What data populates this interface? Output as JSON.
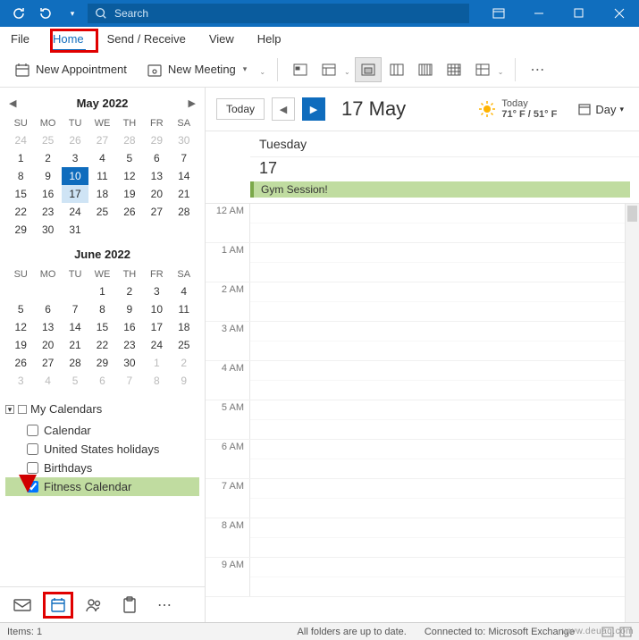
{
  "titlebar": {
    "search_placeholder": "Search"
  },
  "menutabs": {
    "file": "File",
    "home": "Home",
    "send_receive": "Send / Receive",
    "view": "View",
    "help": "Help"
  },
  "ribbon": {
    "new_appointment": "New Appointment",
    "new_meeting": "New Meeting"
  },
  "minical": {
    "may": {
      "title": "May 2022",
      "dow": [
        "SU",
        "MO",
        "TU",
        "WE",
        "TH",
        "FR",
        "SA"
      ],
      "rows": [
        [
          {
            "d": "24",
            "o": true
          },
          {
            "d": "25",
            "o": true
          },
          {
            "d": "26",
            "o": true
          },
          {
            "d": "27",
            "o": true
          },
          {
            "d": "28",
            "o": true
          },
          {
            "d": "29",
            "o": true
          },
          {
            "d": "30",
            "o": true
          }
        ],
        [
          {
            "d": "1"
          },
          {
            "d": "2"
          },
          {
            "d": "3"
          },
          {
            "d": "4"
          },
          {
            "d": "5"
          },
          {
            "d": "6"
          },
          {
            "d": "7"
          }
        ],
        [
          {
            "d": "8"
          },
          {
            "d": "9"
          },
          {
            "d": "10",
            "sel": "blue"
          },
          {
            "d": "11"
          },
          {
            "d": "12"
          },
          {
            "d": "13"
          },
          {
            "d": "14"
          }
        ],
        [
          {
            "d": "15"
          },
          {
            "d": "16"
          },
          {
            "d": "17",
            "sel": "light"
          },
          {
            "d": "18"
          },
          {
            "d": "19"
          },
          {
            "d": "20"
          },
          {
            "d": "21"
          }
        ],
        [
          {
            "d": "22"
          },
          {
            "d": "23"
          },
          {
            "d": "24"
          },
          {
            "d": "25"
          },
          {
            "d": "26"
          },
          {
            "d": "27"
          },
          {
            "d": "28"
          }
        ],
        [
          {
            "d": "29"
          },
          {
            "d": "30"
          },
          {
            "d": "31"
          },
          {
            "d": "",
            "o": true
          },
          {
            "d": "",
            "o": true
          },
          {
            "d": "",
            "o": true
          },
          {
            "d": "",
            "o": true
          }
        ]
      ]
    },
    "june": {
      "title": "June 2022",
      "dow": [
        "SU",
        "MO",
        "TU",
        "WE",
        "TH",
        "FR",
        "SA"
      ],
      "rows": [
        [
          {
            "d": "",
            "o": true
          },
          {
            "d": "",
            "o": true
          },
          {
            "d": "",
            "o": true
          },
          {
            "d": "1"
          },
          {
            "d": "2"
          },
          {
            "d": "3"
          },
          {
            "d": "4"
          }
        ],
        [
          {
            "d": "5"
          },
          {
            "d": "6"
          },
          {
            "d": "7"
          },
          {
            "d": "8"
          },
          {
            "d": "9"
          },
          {
            "d": "10"
          },
          {
            "d": "11"
          }
        ],
        [
          {
            "d": "12"
          },
          {
            "d": "13"
          },
          {
            "d": "14"
          },
          {
            "d": "15"
          },
          {
            "d": "16"
          },
          {
            "d": "17"
          },
          {
            "d": "18"
          }
        ],
        [
          {
            "d": "19"
          },
          {
            "d": "20"
          },
          {
            "d": "21"
          },
          {
            "d": "22"
          },
          {
            "d": "23"
          },
          {
            "d": "24"
          },
          {
            "d": "25"
          }
        ],
        [
          {
            "d": "26"
          },
          {
            "d": "27"
          },
          {
            "d": "28"
          },
          {
            "d": "29"
          },
          {
            "d": "30"
          },
          {
            "d": "1",
            "o": true
          },
          {
            "d": "2",
            "o": true
          }
        ],
        [
          {
            "d": "3",
            "o": true
          },
          {
            "d": "4",
            "o": true
          },
          {
            "d": "5",
            "o": true
          },
          {
            "d": "6",
            "o": true
          },
          {
            "d": "7",
            "o": true
          },
          {
            "d": "8",
            "o": true
          },
          {
            "d": "9",
            "o": true
          }
        ]
      ]
    }
  },
  "caltree": {
    "header": "My Calendars",
    "items": [
      {
        "label": "Calendar",
        "checked": false,
        "selected": false
      },
      {
        "label": "United States holidays",
        "checked": false,
        "selected": false
      },
      {
        "label": "Birthdays",
        "checked": false,
        "selected": false
      },
      {
        "label": "Fitness Calendar",
        "checked": true,
        "selected": true
      }
    ]
  },
  "calhead": {
    "today": "Today",
    "date": "17 May",
    "weather_label": "Today",
    "weather_temp": "71° F / 51° F",
    "view_label": "Day"
  },
  "day": {
    "dayname": "Tuesday",
    "daynum": "17",
    "event": "Gym Session!",
    "times": [
      "12 AM",
      "1 AM",
      "2 AM",
      "3 AM",
      "4 AM",
      "5 AM",
      "6 AM",
      "7 AM",
      "8 AM",
      "9 AM"
    ]
  },
  "statusbar": {
    "items": "Items: 1",
    "folders": "All folders are up to date.",
    "connected": "Connected to: Microsoft Exchange"
  },
  "watermark": "www.deuaq.com"
}
